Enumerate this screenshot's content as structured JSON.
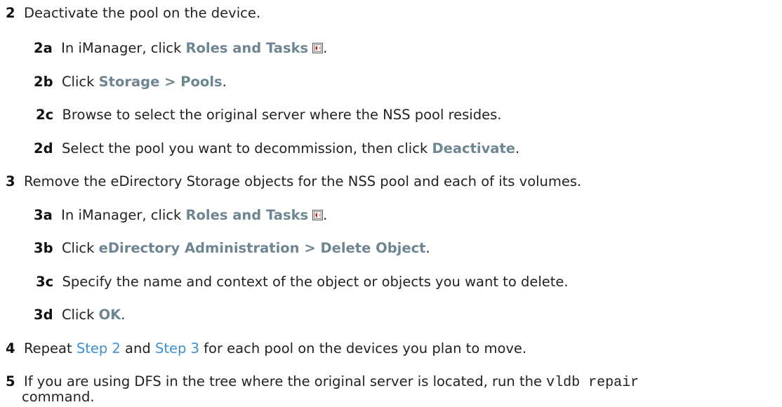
{
  "steps": {
    "s2": {
      "num": "2",
      "text": "Deactivate the pool on the device."
    },
    "s2a": {
      "num": "2a",
      "pre": "In iManager, click ",
      "ui": "Roles and Tasks",
      "post": "."
    },
    "s2b": {
      "num": "2b",
      "pre": "Click ",
      "ui": "Storage > Pools",
      "post": "."
    },
    "s2c": {
      "num": "2c",
      "text": "Browse to select the original server where the NSS pool resides."
    },
    "s2d": {
      "num": "2d",
      "pre": "Select the pool you want to decommission, then click ",
      "ui": "Deactivate",
      "post": "."
    },
    "s3": {
      "num": "3",
      "text": "Remove the eDirectory Storage objects for the NSS pool and each of its volumes."
    },
    "s3a": {
      "num": "3a",
      "pre": "In iManager, click ",
      "ui": "Roles and Tasks",
      "post": "."
    },
    "s3b": {
      "num": "3b",
      "pre": "Click ",
      "ui": "eDirectory Administration > Delete Object",
      "post": "."
    },
    "s3c": {
      "num": "3c",
      "text": "Specify the name and context of the object or objects you want to delete."
    },
    "s3d": {
      "num": "3d",
      "pre": "Click ",
      "ui": "OK",
      "post": "."
    },
    "s4": {
      "num": "4",
      "pre": "Repeat ",
      "link1": "Step 2",
      "mid": " and ",
      "link2": "Step 3",
      "post": " for each pool on the devices you plan to move."
    },
    "s5": {
      "num": "5",
      "pre": "If you are using DFS in the tree where the original server is located, run the ",
      "code": "vldb repair",
      "cont": "command."
    }
  },
  "icons": {
    "roles_tasks": "roles-and-tasks-icon"
  },
  "colors": {
    "ui_text": "#6e8592",
    "link": "#3c8fd2"
  }
}
